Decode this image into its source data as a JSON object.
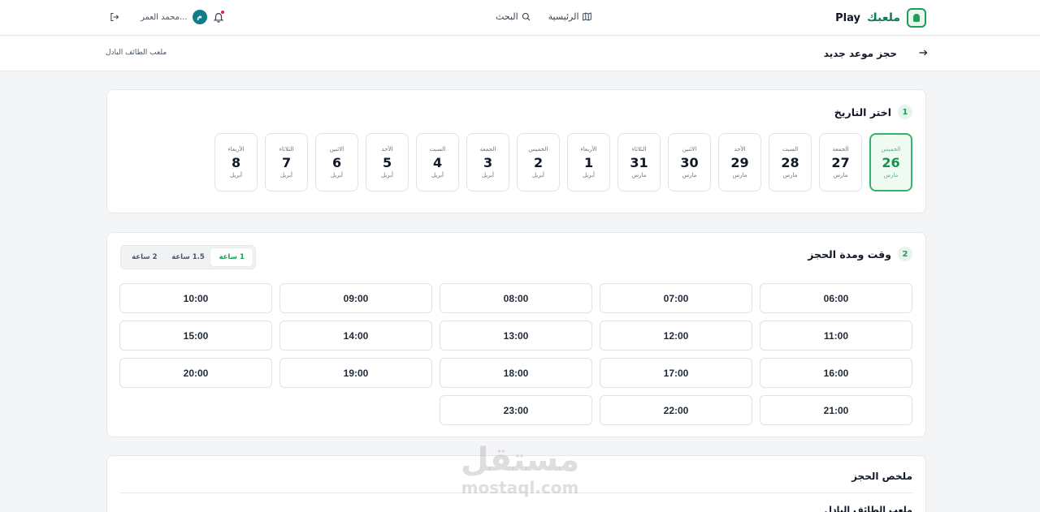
{
  "nav": {
    "brand_name": "ملعبك",
    "brand_suffix": "Play",
    "home_label": "الرئيسية",
    "search_label": "البحث",
    "user_name": "محمد العمر...",
    "avatar_initial": "م"
  },
  "subheader": {
    "title": "حجز موعد جديد",
    "venue": "ملعب الطائف البادل"
  },
  "date_step": {
    "number": "1",
    "title": "اختر التاريخ",
    "dates": [
      {
        "dow": "الخميس",
        "day": "26",
        "month": "مارس",
        "selected": true
      },
      {
        "dow": "الجمعة",
        "day": "27",
        "month": "مارس"
      },
      {
        "dow": "السبت",
        "day": "28",
        "month": "مارس"
      },
      {
        "dow": "الأحد",
        "day": "29",
        "month": "مارس"
      },
      {
        "dow": "الاثنين",
        "day": "30",
        "month": "مارس"
      },
      {
        "dow": "الثلاثاء",
        "day": "31",
        "month": "مارس"
      },
      {
        "dow": "الأربعاء",
        "day": "1",
        "month": "أبريل"
      },
      {
        "dow": "الخميس",
        "day": "2",
        "month": "أبريل"
      },
      {
        "dow": "الجمعة",
        "day": "3",
        "month": "أبريل"
      },
      {
        "dow": "السبت",
        "day": "4",
        "month": "أبريل"
      },
      {
        "dow": "الأحد",
        "day": "5",
        "month": "أبريل"
      },
      {
        "dow": "الاثنين",
        "day": "6",
        "month": "أبريل"
      },
      {
        "dow": "الثلاثاء",
        "day": "7",
        "month": "أبريل"
      },
      {
        "dow": "الأربعاء",
        "day": "8",
        "month": "أبريل"
      }
    ]
  },
  "time_step": {
    "number": "2",
    "title": "وقت ومدة الحجز",
    "durations": [
      {
        "label": "1 ساعة",
        "active": true
      },
      {
        "label": "1.5 ساعة"
      },
      {
        "label": "2 ساعة"
      }
    ],
    "slots": [
      "06:00",
      "07:00",
      "08:00",
      "09:00",
      "10:00",
      "11:00",
      "12:00",
      "13:00",
      "14:00",
      "15:00",
      "16:00",
      "17:00",
      "18:00",
      "19:00",
      "20:00",
      "21:00",
      "22:00",
      "23:00"
    ]
  },
  "summary": {
    "title": "ملخص الحجز",
    "venue": "ملعب الطائف البادل"
  },
  "watermark": {
    "arabic": "مستقل",
    "latin": "mostaql.com"
  },
  "colors": {
    "accent": "#1f9d55",
    "selected_bg": "#effaf3",
    "avatar": "#0e7c8b"
  }
}
